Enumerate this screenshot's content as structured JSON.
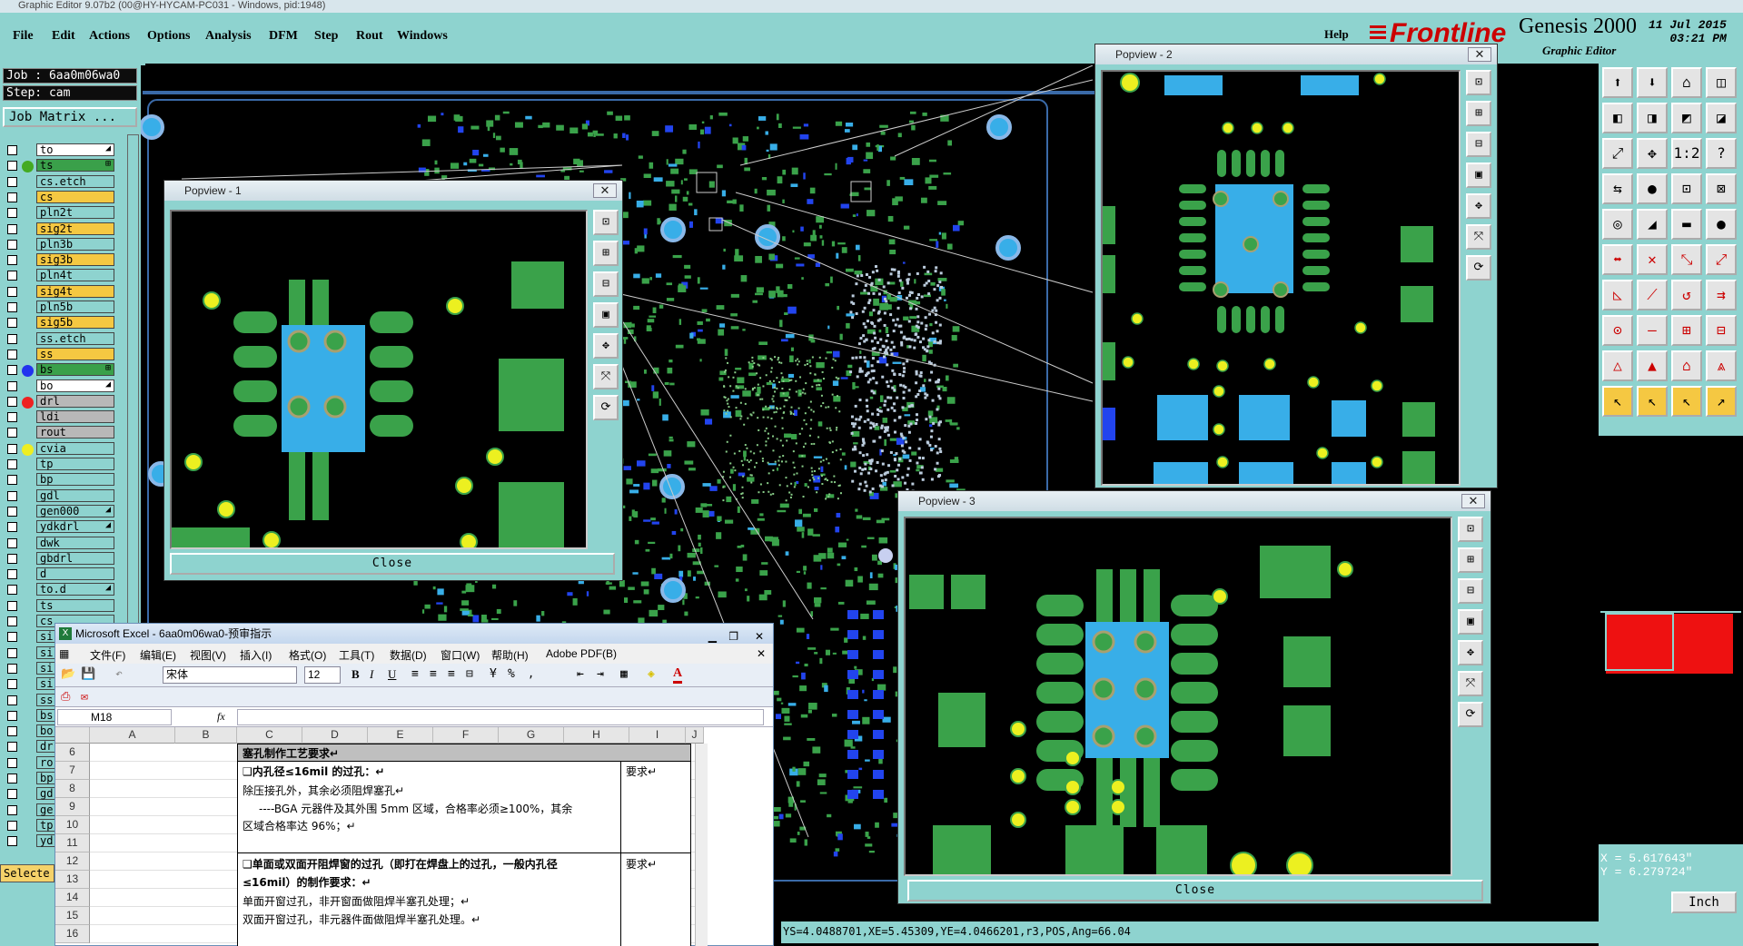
{
  "window_title": "Graphic Editor 9.07b2 (00@HY-HYCAM-PC031 - Windows, pid:1948)",
  "menu": [
    "File",
    "Edit",
    "Actions",
    "Options",
    "Analysis",
    "DFM",
    "Step",
    "Rout",
    "Windows"
  ],
  "help_label": "Help",
  "brand": {
    "logo": "Frontline",
    "product": "Genesis 2000",
    "subtitle": "Graphic Editor",
    "date": "11 Jul 2015",
    "time": "03:21 PM"
  },
  "job": "Job : 6aa0m06wa0",
  "step": "Step: cam",
  "job_matrix": "Job Matrix ...",
  "layers": [
    {
      "name": "to",
      "color": "#ffffff",
      "dot": "",
      "mark": "◢"
    },
    {
      "name": "ts",
      "color": "#3aa04a",
      "dot": "#44aa22",
      "mark": "⊞"
    },
    {
      "name": "cs.etch",
      "color": "#8ed3cf",
      "dot": "",
      "mark": ""
    },
    {
      "name": "cs",
      "color": "#f5c842",
      "dot": "",
      "mark": ""
    },
    {
      "name": "pln2t",
      "color": "#8ed3cf",
      "dot": "",
      "mark": ""
    },
    {
      "name": "sig2t",
      "color": "#f5c842",
      "dot": "",
      "mark": ""
    },
    {
      "name": "pln3b",
      "color": "#8ed3cf",
      "dot": "",
      "mark": ""
    },
    {
      "name": "sig3b",
      "color": "#f5c842",
      "dot": "",
      "mark": ""
    },
    {
      "name": "pln4t",
      "color": "#8ed3cf",
      "dot": "",
      "mark": ""
    },
    {
      "name": "sig4t",
      "color": "#f5c842",
      "dot": "",
      "mark": ""
    },
    {
      "name": "pln5b",
      "color": "#8ed3cf",
      "dot": "",
      "mark": ""
    },
    {
      "name": "sig5b",
      "color": "#f5c842",
      "dot": "",
      "mark": ""
    },
    {
      "name": "ss.etch",
      "color": "#8ed3cf",
      "dot": "",
      "mark": ""
    },
    {
      "name": "ss",
      "color": "#f5c842",
      "dot": "",
      "mark": ""
    },
    {
      "name": "bs",
      "color": "#3aa04a",
      "dot": "#2233ee",
      "mark": "⊞"
    },
    {
      "name": "bo",
      "color": "#ffffff",
      "dot": "",
      "mark": "◢"
    },
    {
      "name": "drl",
      "color": "#b8b8b8",
      "dot": "#ee2222",
      "mark": ""
    },
    {
      "name": "ldi",
      "color": "#b8b8b8",
      "dot": "",
      "mark": ""
    },
    {
      "name": "rout",
      "color": "#b8b8b8",
      "dot": "",
      "mark": ""
    },
    {
      "name": "cvia",
      "color": "#8ed3cf",
      "dot": "#eeee22",
      "mark": ""
    },
    {
      "name": "tp",
      "color": "#8ed3cf",
      "dot": "",
      "mark": ""
    },
    {
      "name": "bp",
      "color": "#8ed3cf",
      "dot": "",
      "mark": ""
    },
    {
      "name": "gdl",
      "color": "#8ed3cf",
      "dot": "",
      "mark": ""
    },
    {
      "name": "gen000",
      "color": "#8ed3cf",
      "dot": "",
      "mark": "◢"
    },
    {
      "name": "ydkdrl",
      "color": "#8ed3cf",
      "dot": "",
      "mark": "◢"
    },
    {
      "name": "dwk",
      "color": "#8ed3cf",
      "dot": "",
      "mark": ""
    },
    {
      "name": "gbdrl",
      "color": "#8ed3cf",
      "dot": "",
      "mark": ""
    },
    {
      "name": "d",
      "color": "#8ed3cf",
      "dot": "",
      "mark": ""
    },
    {
      "name": "to.d",
      "color": "#8ed3cf",
      "dot": "",
      "mark": "◢"
    },
    {
      "name": "ts",
      "color": "#8ed3cf",
      "dot": "",
      "mark": ""
    },
    {
      "name": "cs",
      "color": "#8ed3cf",
      "dot": "",
      "mark": ""
    },
    {
      "name": "si",
      "color": "#8ed3cf",
      "dot": "",
      "mark": ""
    },
    {
      "name": "si",
      "color": "#8ed3cf",
      "dot": "",
      "mark": ""
    },
    {
      "name": "si",
      "color": "#8ed3cf",
      "dot": "",
      "mark": ""
    },
    {
      "name": "si",
      "color": "#8ed3cf",
      "dot": "",
      "mark": ""
    },
    {
      "name": "ss",
      "color": "#8ed3cf",
      "dot": "",
      "mark": ""
    },
    {
      "name": "bs",
      "color": "#8ed3cf",
      "dot": "",
      "mark": ""
    },
    {
      "name": "bo",
      "color": "#8ed3cf",
      "dot": "",
      "mark": ""
    },
    {
      "name": "dr",
      "color": "#8ed3cf",
      "dot": "",
      "mark": ""
    },
    {
      "name": "ro",
      "color": "#8ed3cf",
      "dot": "",
      "mark": ""
    },
    {
      "name": "bp",
      "color": "#8ed3cf",
      "dot": "",
      "mark": ""
    },
    {
      "name": "gd",
      "color": "#8ed3cf",
      "dot": "",
      "mark": ""
    },
    {
      "name": "ge",
      "color": "#8ed3cf",
      "dot": "",
      "mark": ""
    },
    {
      "name": "tp",
      "color": "#8ed3cf",
      "dot": "",
      "mark": ""
    },
    {
      "name": "yd",
      "color": "#8ed3cf",
      "dot": "",
      "mark": ""
    }
  ],
  "select_label": "Selecte",
  "popviews": [
    {
      "title": "Popview - 1",
      "close": "Close"
    },
    {
      "title": "Popview - 2",
      "close": "Close"
    },
    {
      "title": "Popview - 3",
      "close": "Close"
    }
  ],
  "coords": {
    "x": "X = 5.617643\"",
    "y": "Y = 6.279724\""
  },
  "unit": "Inch",
  "status": "YS=4.0488701,XE=5.45309,YE=4.0466201,r3,POS,Ang=66.04",
  "excel": {
    "title": "Microsoft Excel - 6aa0m06wa0-预审指示",
    "menu": [
      "文件(F)",
      "编辑(E)",
      "视图(V)",
      "插入(I)",
      "格式(O)",
      "工具(T)",
      "数据(D)",
      "窗口(W)",
      "帮助(H)",
      "Adobe PDF(B)"
    ],
    "font": "宋体",
    "size": "12",
    "cellref": "M18",
    "fx": "fx",
    "columns": [
      "A",
      "B",
      "C",
      "D",
      "E",
      "F",
      "G",
      "H",
      "I",
      "J"
    ],
    "rows": [
      "6",
      "7",
      "8",
      "9",
      "10",
      "11",
      "12",
      "13",
      "14",
      "15",
      "16"
    ],
    "cells": {
      "header": "塞孔制作工艺要求↵",
      "t1": "❑内孔径≤16mil 的过孔：↵",
      "t1a": "除压接孔外，其余必须阻焊塞孔↵",
      "t1b": "----BGA 元器件及其外围 5mm 区域，合格率必须≥100%，其余",
      "t1c": "区域合格率达 96%；↵",
      "req1": "要求↵",
      "t2": "❑单面或双面开阻焊窗的过孔（即打在焊盘上的过孔，一般内孔径",
      "t2b": "≤16mil）的制作要求：↵",
      "t2c": "单面开窗过孔，非开窗面做阻焊半塞孔处理；↵",
      "t2d": "双面开窗过孔，非元器件面做阻焊半塞孔处理。↵",
      "req2": "要求↵"
    }
  }
}
